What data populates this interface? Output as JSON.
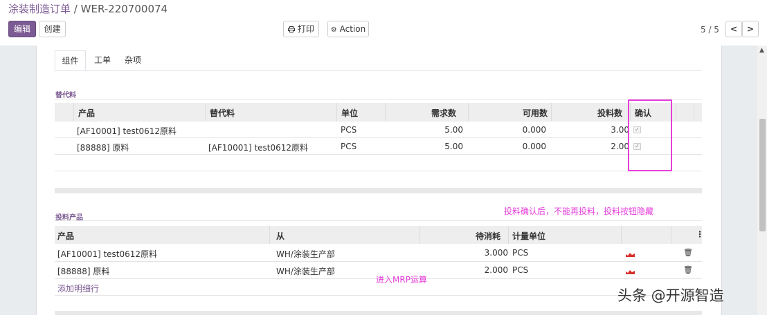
{
  "breadcrumb": {
    "parent": "涂装制造订单",
    "separator": "/",
    "current": "WER-220700074"
  },
  "toolbar": {
    "edit": "编辑",
    "create": "创建",
    "print": "打印",
    "action": "Action"
  },
  "icons": {
    "print": "printer-icon",
    "action": "gear-icon",
    "prev": "chevron-left-icon",
    "next": "chevron-right-icon",
    "chart": "chart-icon",
    "trash": "trash-icon"
  },
  "pager": {
    "value": "5 / 5",
    "prev": "<",
    "next": ">"
  },
  "tabs": [
    "组件",
    "工单",
    "杂项"
  ],
  "substitute": {
    "title": "替代料",
    "headers": [
      "产品",
      "替代料",
      "单位",
      "需求数",
      "可用数",
      "投料数",
      "确认"
    ],
    "rows": [
      {
        "product": "[AF10001] test0612原料",
        "substitute": "",
        "unit": "PCS",
        "required": "5.00",
        "available": "0.000",
        "issued": "3.00",
        "confirmed": true
      },
      {
        "product": "[88888] 原料",
        "substitute": "[AF10001] test0612原料",
        "unit": "PCS",
        "required": "5.00",
        "available": "0.000",
        "issued": "2.00",
        "confirmed": true
      }
    ]
  },
  "consumed": {
    "title": "投料产品",
    "headers": [
      "产品",
      "从",
      "待消耗",
      "计量单位"
    ],
    "rows": [
      {
        "product": "[AF10001] test0612原料",
        "from": "WH/涂装生产部",
        "to_consume": "3.000",
        "uom": "PCS"
      },
      {
        "product": "[88888] 原料",
        "from": "WH/涂装生产部",
        "to_consume": "2.000",
        "uom": "PCS"
      }
    ],
    "add_line": "添加明细行"
  },
  "annotations": {
    "note1": "投料确认后，不能再投料，投料按钮隐藏",
    "note2": "进入MRP运算"
  },
  "watermark": "头条 @开源智造",
  "colors": {
    "brand": "#7c5a93",
    "highlight": "#e53fd9",
    "chart_icon": "#d9302c"
  }
}
